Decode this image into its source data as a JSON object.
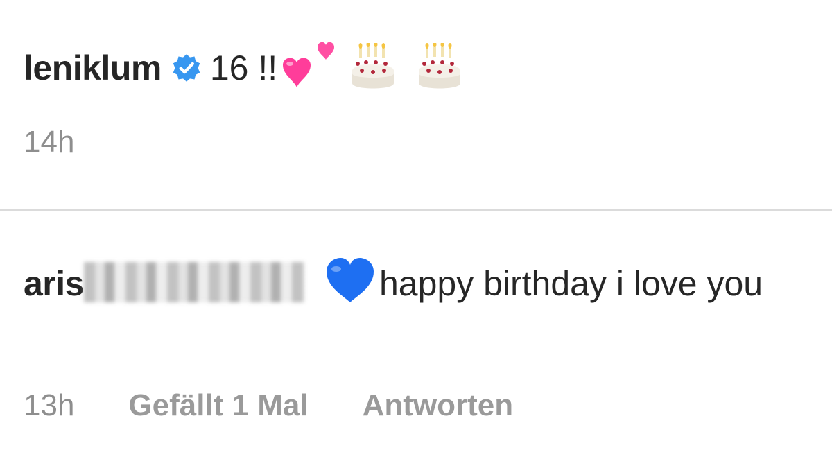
{
  "post": {
    "username": "leniklum",
    "verified_icon": "verified-badge-icon",
    "caption": "16 !!",
    "caption_emojis": [
      "two-hearts-icon",
      "birthday-cake-icon",
      "birthday-cake-icon"
    ],
    "timestamp": "14h"
  },
  "comment": {
    "username_visible": "aris",
    "username_rest_pixelated": true,
    "emoji": "blue-heart-icon",
    "text": "happy birthday i love you",
    "timestamp": "13h",
    "likes_label": "Gefällt 1 Mal",
    "reply_label": "Antworten"
  },
  "colors": {
    "text": "#262626",
    "secondary": "#8e8e8e",
    "divider": "#dbdbdb",
    "verified_blue": "#3897f0",
    "heart_pink": "#ff4fa3",
    "heart_blue": "#1e6ff2"
  }
}
